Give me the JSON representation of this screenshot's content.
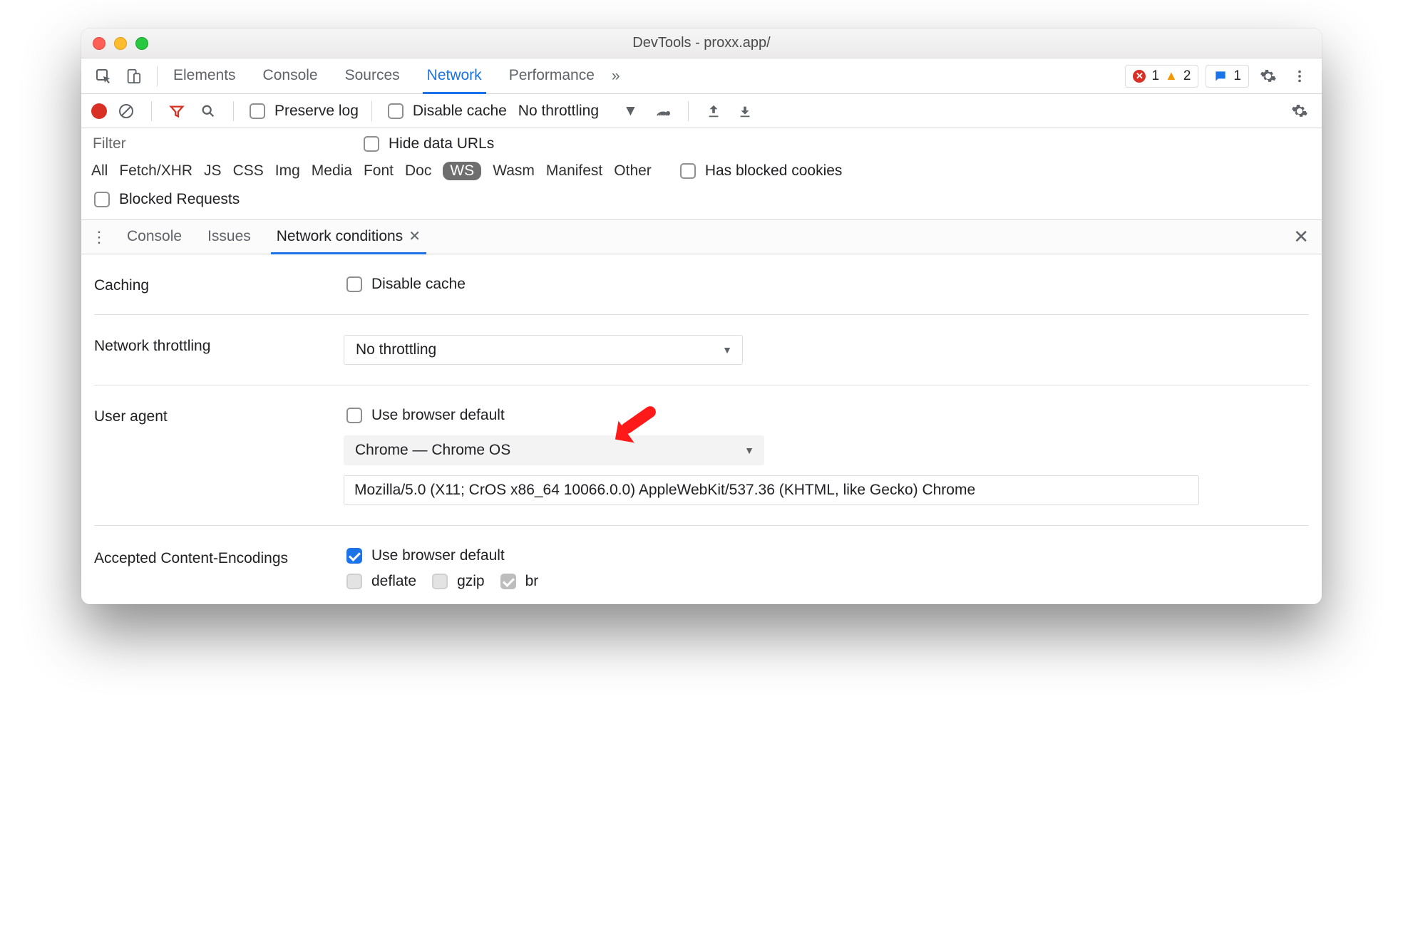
{
  "window": {
    "title": "DevTools - proxx.app/"
  },
  "main_tabs": {
    "items": [
      "Elements",
      "Console",
      "Sources",
      "Network",
      "Performance"
    ],
    "active_index": 3,
    "overflow_glyph": "»"
  },
  "status": {
    "errors": "1",
    "warnings": "2",
    "messages": "1"
  },
  "network_toolbar": {
    "preserve_log": "Preserve log",
    "disable_cache": "Disable cache",
    "throttling": "No throttling"
  },
  "filter": {
    "placeholder": "Filter",
    "hide_data_urls": "Hide data URLs",
    "types": [
      "All",
      "Fetch/XHR",
      "JS",
      "CSS",
      "Img",
      "Media",
      "Font",
      "Doc",
      "WS",
      "Wasm",
      "Manifest",
      "Other"
    ],
    "selected_type_index": 8,
    "has_blocked_cookies": "Has blocked cookies",
    "blocked_requests": "Blocked Requests"
  },
  "drawer": {
    "tabs": [
      "Console",
      "Issues",
      "Network conditions"
    ],
    "active_index": 2
  },
  "network_conditions": {
    "caching_label": "Caching",
    "caching_checkbox": "Disable cache",
    "throttling_label": "Network throttling",
    "throttling_value": "No throttling",
    "ua_label": "User agent",
    "ua_use_default": "Use browser default",
    "ua_select": "Chrome — Chrome OS",
    "ua_string": "Mozilla/5.0 (X11; CrOS x86_64 10066.0.0) AppleWebKit/537.36 (KHTML, like Gecko) Chrome",
    "enc_label": "Accepted Content-Encodings",
    "enc_use_default": "Use browser default",
    "enc_options": [
      "deflate",
      "gzip",
      "br"
    ]
  }
}
